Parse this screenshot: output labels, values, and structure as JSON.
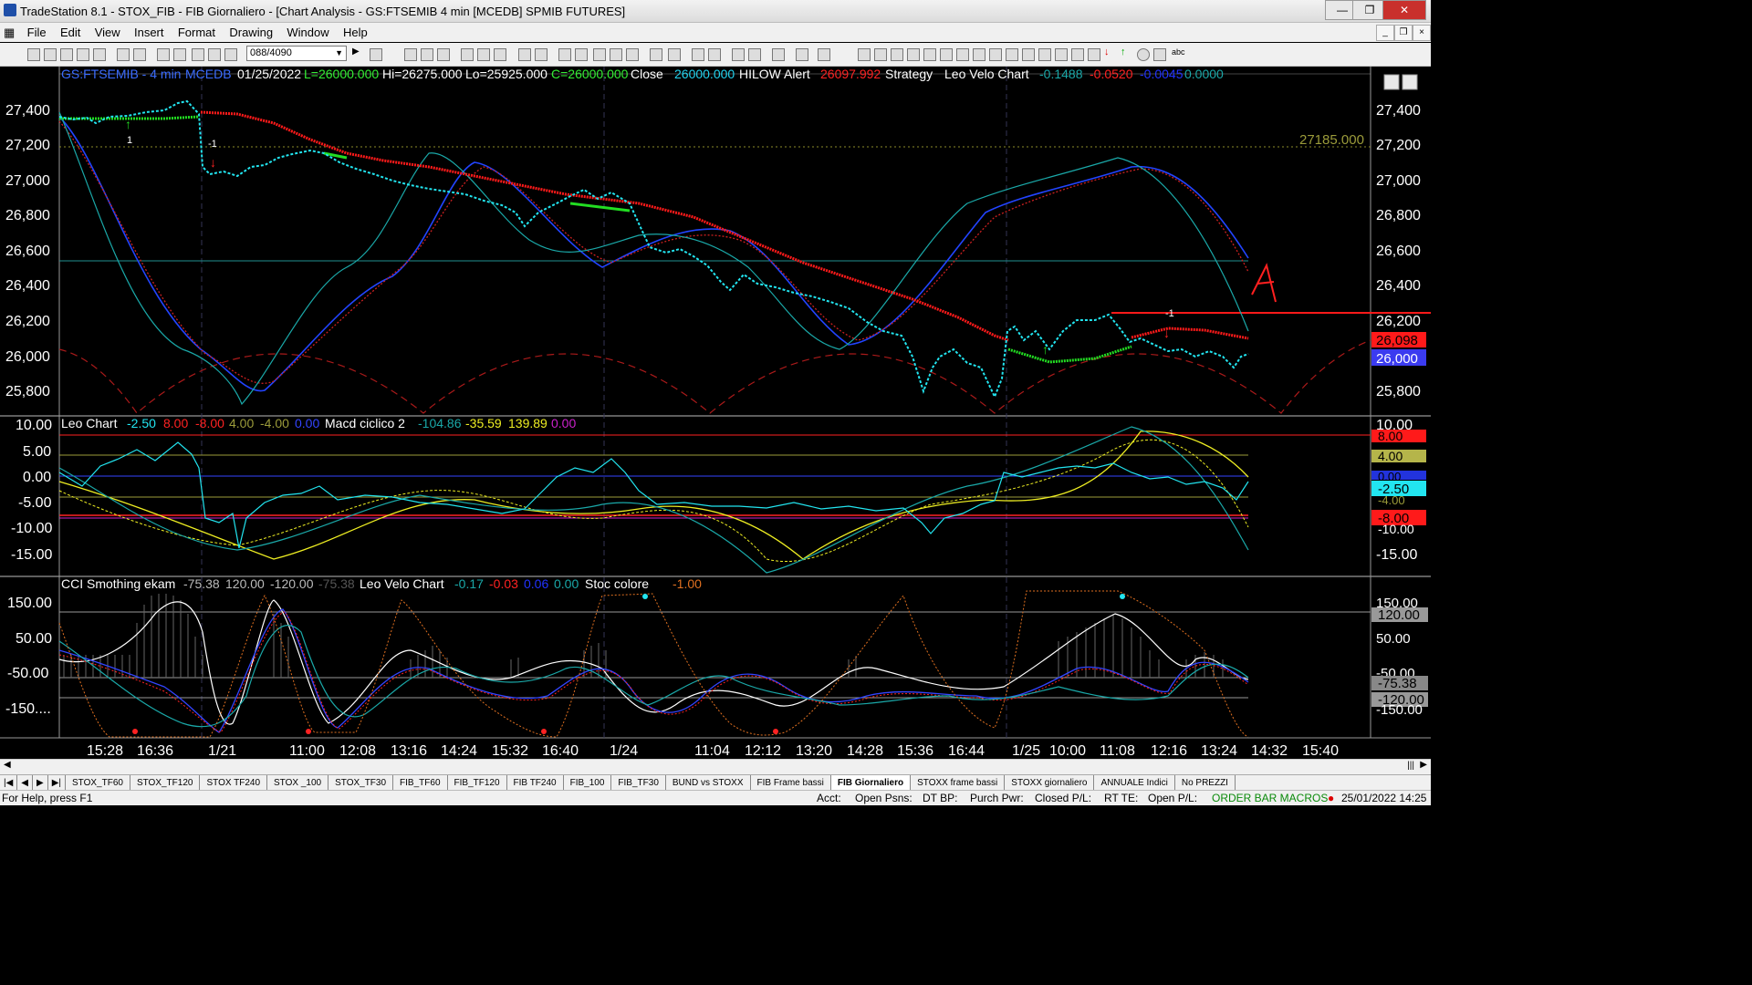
{
  "window": {
    "title": "TradeStation 8.1 - STOX_FIB - FIB Giornaliero - [Chart Analysis - GS:FTSEMIB  4 min  [MCEDB] SPMIB FUTURES]"
  },
  "menu": [
    "File",
    "Edit",
    "View",
    "Insert",
    "Format",
    "Drawing",
    "Window",
    "Help"
  ],
  "toolbar": {
    "combo_value": "088/4090"
  },
  "chart": {
    "symbol": "GS:FTSEMIB - 4 min",
    "feed": "MCEDB",
    "date": "01/25/2022",
    "last": "L=26000.000",
    "high": "Hi=26275.000",
    "low": "Lo=25925.000",
    "close_c": "C=26000.000",
    "close_label": "Close",
    "close_value": "26000.000",
    "hilow_label": "HILOW Alert",
    "hilow_value": "26097.992",
    "strategy": "Strategy",
    "velo_label": "Leo Velo Chart",
    "velo_v1": "-0.1488",
    "velo_v2": "-0.0520",
    "velo_v3": "-0.0045",
    "velo_v4": "0.0000",
    "level_line_label": "27185.000",
    "price_axis": [
      "27,400",
      "27,200",
      "27,000",
      "26,800",
      "26,600",
      "26,400",
      "26,200",
      "26,000",
      "25,800"
    ],
    "price_tag_red": "26,098",
    "price_tag_blue": "26,000",
    "signal_labels": [
      "1",
      "-1",
      "-1"
    ],
    "annotation": "A"
  },
  "panel2": {
    "name": "Leo Chart",
    "v": [
      "-2.50",
      "8.00",
      "-8.00",
      "4.00",
      "-4.00",
      "0.00"
    ],
    "macd": "Macd ciclico 2",
    "mv": [
      "-104.86",
      "-35.59",
      "139.89",
      "0.00"
    ],
    "axis": [
      "10.00",
      "5.00",
      "0.00",
      "-5.00",
      "-10.00",
      "-15.00"
    ],
    "tags": [
      "8.00",
      "4.00",
      "0.00",
      "-2.50",
      "-4.00",
      "-8.00",
      "-10.00"
    ]
  },
  "panel3": {
    "name": "CCI Smothing ekam",
    "v": [
      "-75.38",
      "120.00",
      "-120.00",
      "-75.38"
    ],
    "velo": "Leo Velo Chart",
    "vv": [
      "-0.17",
      "-0.03",
      "0.06",
      "0.00"
    ],
    "stoc": "Stoc colore",
    "stoc_v": "-1.00",
    "axis": [
      "150.00",
      "50.00",
      "-50.00",
      "-150...."
    ],
    "tags": [
      "150.00",
      "120.00",
      "50.00",
      "-50.00",
      "-75.38",
      "-120.00",
      "-150.00"
    ]
  },
  "time_axis": [
    "15:28",
    "16:36",
    "1/21",
    "11:00",
    "12:08",
    "13:16",
    "14:24",
    "15:32",
    "16:40",
    "1/24",
    "11:04",
    "12:12",
    "13:20",
    "14:28",
    "15:36",
    "16:44",
    "1/25",
    "10:00",
    "11:08",
    "12:16",
    "13:24",
    "14:32",
    "15:40"
  ],
  "tabs": [
    "STOX_TF60",
    "STOX_TF120",
    "STOX TF240",
    "STOX _100",
    "STOX_TF30",
    "FIB_TF60",
    "FIB_TF120",
    "FIB TF240",
    "FIB_100",
    "FIB_TF30",
    "BUND vs STOXX",
    "FIB Frame bassi",
    "FIB Giornaliero",
    "STOXX frame bassi",
    "STOXX giornaliero",
    "ANNUALE Indici",
    "No PREZZI"
  ],
  "active_tab": "FIB Giornaliero",
  "status": {
    "help": "For Help, press F1",
    "acct": "Acct:",
    "open_psns": "Open Psns:",
    "dt_bp": "DT BP:",
    "purch_pwr": "Purch Pwr:",
    "closed_pl": "Closed P/L:",
    "rt_te": "RT TE:",
    "open_pl": "Open P/L:",
    "macros": "ORDER BAR  MACROS",
    "datetime": "25/01/2022 14:25"
  }
}
